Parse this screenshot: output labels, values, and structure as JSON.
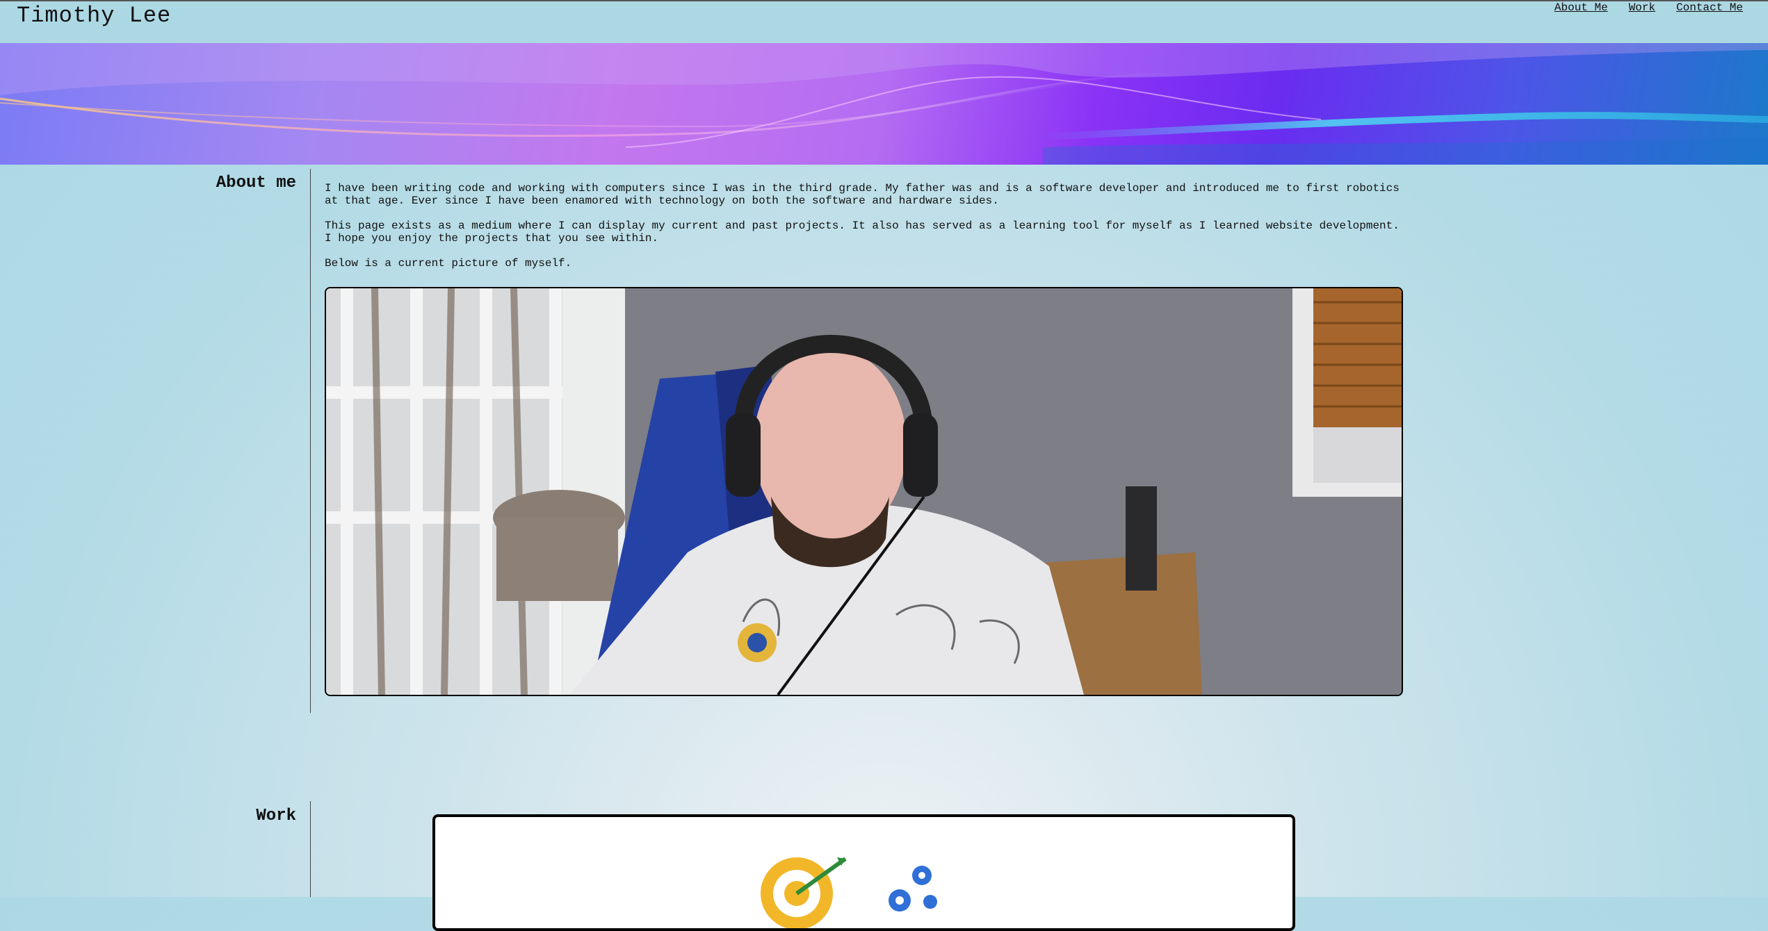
{
  "header": {
    "title": "Timothy Lee",
    "nav": [
      {
        "label": "About Me"
      },
      {
        "label": "Work"
      },
      {
        "label": "Contact Me"
      }
    ]
  },
  "about": {
    "heading": "About me",
    "paragraphs": [
      "I have been writing code and working with computers since I was in the third grade. My father was and is a software developer and introduced me to first robotics at that age. Ever since I have been enamored with technology on both the software and hardware sides.",
      "This page exists as a medium where I can display my current and past projects. It also has served as a learning tool for myself as I learned website development. I hope you enjoy the projects that you see within.",
      "Below is a current picture of myself."
    ]
  },
  "work": {
    "heading": "Work"
  },
  "colors": {
    "page_bg": "#acd8e4",
    "banner_left": "#7b7bf4",
    "banner_mid": "#c377ee",
    "banner_right": "#1b79c9"
  }
}
